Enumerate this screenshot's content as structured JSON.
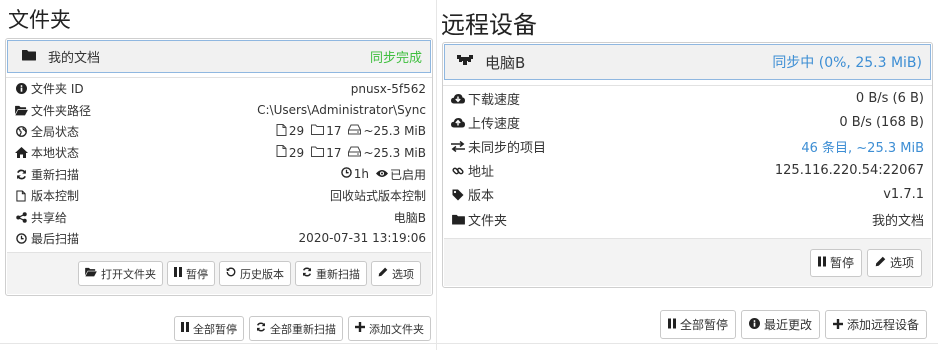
{
  "left": {
    "section_title": "文件夹",
    "folder": {
      "name": "我的文档",
      "status": "同步完成",
      "status_color": "#3fbf3f",
      "rows": [
        {
          "icon": "info-circle-icon",
          "label": "文件夹 ID",
          "value": "pnusx-5f562"
        },
        {
          "icon": "folder-open-icon",
          "label": "文件夹路径",
          "value": "C:\\Users\\Administrator\\Sync"
        },
        {
          "icon": "globe-icon",
          "label": "全局状态",
          "files": "29",
          "dirs": "17",
          "size": "~25.3 MiB"
        },
        {
          "icon": "home-icon",
          "label": "本地状态",
          "files": "29",
          "dirs": "17",
          "size": "~25.3 MiB"
        },
        {
          "icon": "refresh-icon",
          "label": "重新扫描",
          "interval": "1h",
          "watch": "已启用"
        },
        {
          "icon": "file-icon",
          "label": "版本控制",
          "value": "回收站式版本控制"
        },
        {
          "icon": "share-icon",
          "label": "共享给",
          "value": "电脑B"
        },
        {
          "icon": "clock-icon",
          "label": "最后扫描",
          "value": "2020-07-31 13:19:06"
        }
      ],
      "buttons": {
        "open": "打开文件夹",
        "pause": "暂停",
        "versions": "历史版本",
        "rescan": "重新扫描",
        "options": "选项"
      }
    },
    "bottom_buttons": {
      "pause_all": "全部暂停",
      "rescan_all": "全部重新扫描",
      "add_folder": "添加文件夹"
    }
  },
  "right": {
    "section_title": "远程设备",
    "device": {
      "name": "电脑B",
      "status": "同步中 (0%, 25.3 MiB)",
      "status_color": "#3d8ed4",
      "rows": [
        {
          "icon": "cloud-download-icon",
          "label": "下载速度",
          "value": "0 B/s (6 B)"
        },
        {
          "icon": "cloud-upload-icon",
          "label": "上传速度",
          "value": "0 B/s (168 B)"
        },
        {
          "icon": "exchange-icon",
          "label": "未同步的项目",
          "value": "46 条目, ~25.3 MiB"
        },
        {
          "icon": "link-icon",
          "label": "地址",
          "value": "125.116.220.54:22067"
        },
        {
          "icon": "tag-icon",
          "label": "版本",
          "value": "v1.7.1"
        },
        {
          "icon": "folder-icon",
          "label": "文件夹",
          "value": "我的文档"
        }
      ],
      "buttons": {
        "pause": "暂停",
        "options": "选项"
      }
    },
    "bottom_buttons": {
      "pause_all": "全部暂停",
      "recent_changes": "最近更改",
      "add_device": "添加远程设备"
    }
  }
}
